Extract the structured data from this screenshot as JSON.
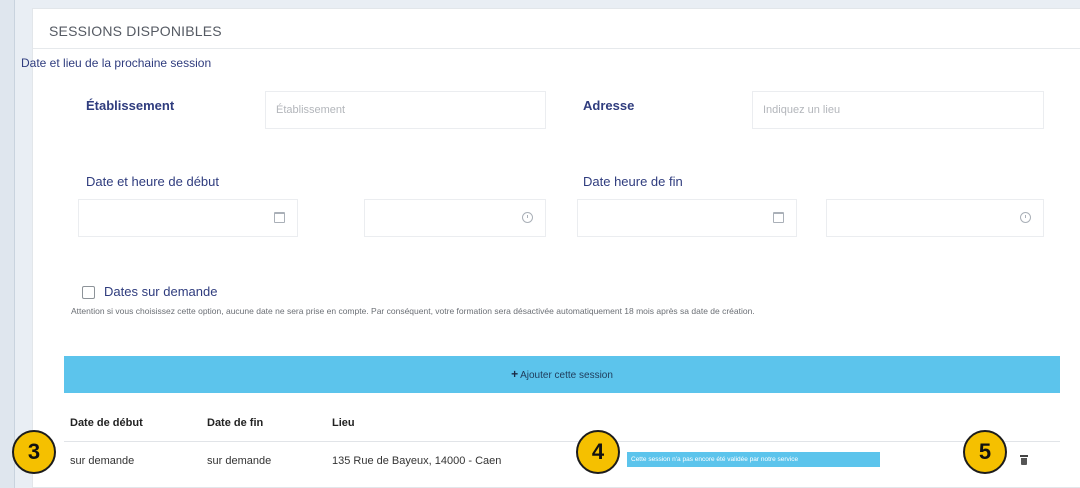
{
  "section": {
    "title": "SESSIONS DISPONIBLES",
    "subtitle": "Date et lieu de la prochaine session"
  },
  "form": {
    "etablissement_label": "Établissement",
    "etablissement_placeholder": "Établissement",
    "adresse_label": "Adresse",
    "adresse_placeholder": "Indiquez un lieu",
    "debut_label": "Date et heure de début",
    "fin_label": "Date heure de fin",
    "sur_demande_label": "Dates sur demande",
    "sur_demande_checked": false,
    "warning": "Attention si vous choisissez cette option, aucune date ne sera prise en compte. Par conséquent, votre formation sera désactivée automatiquement 18 mois après sa date de création."
  },
  "add_button": {
    "label": "Ajouter cette session",
    "icon": "plus-icon"
  },
  "table": {
    "headers": [
      "Date de début",
      "Date de fin",
      "Lieu"
    ],
    "rows": [
      {
        "date_debut": "sur demande",
        "date_fin": "sur demande",
        "lieu": "135 Rue de Bayeux, 14000 - Caen",
        "status": "Cette session n'a pas encore été validée par notre service",
        "action_icon": "trash-icon"
      }
    ]
  },
  "callouts": [
    "3",
    "4",
    "5"
  ],
  "colors": {
    "accent": "#5cc4ec",
    "label": "#2f3c7e",
    "callout": "#f5c000"
  }
}
